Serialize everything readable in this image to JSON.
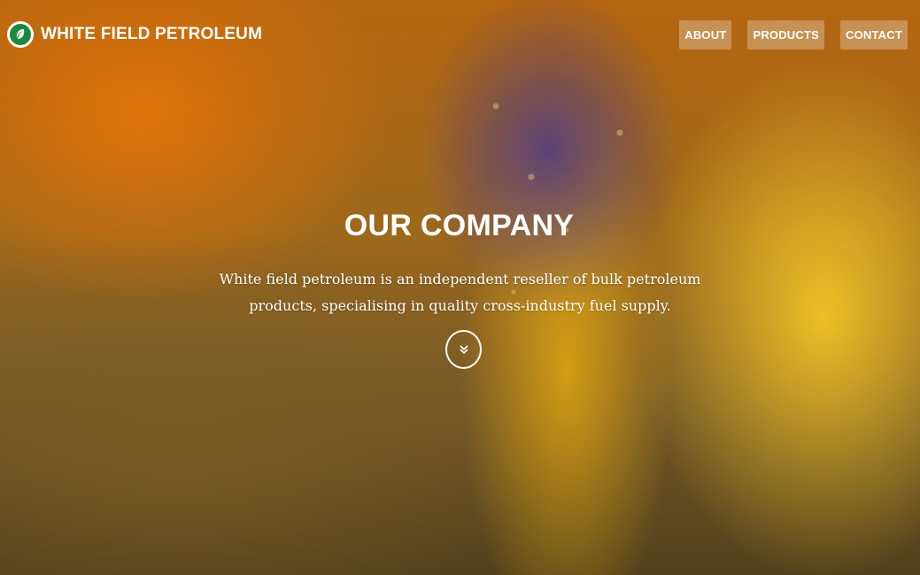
{
  "header": {
    "brand_name": "WHITE FIELD PETROLEUM",
    "logo_icon": "leaf-icon",
    "nav": [
      {
        "label": "ABOUT"
      },
      {
        "label": "PRODUCTS"
      },
      {
        "label": "CONTACT"
      }
    ]
  },
  "hero": {
    "title": "OUR COMPANY",
    "subtitle": "White field petroleum is an independent reseller of bulk petroleum products, specialising in quality cross-industry fuel supply.",
    "scroll_icon": "chevron-double-down-icon"
  },
  "colors": {
    "logo_green": "#1c8a3c",
    "text": "#ffffff"
  }
}
